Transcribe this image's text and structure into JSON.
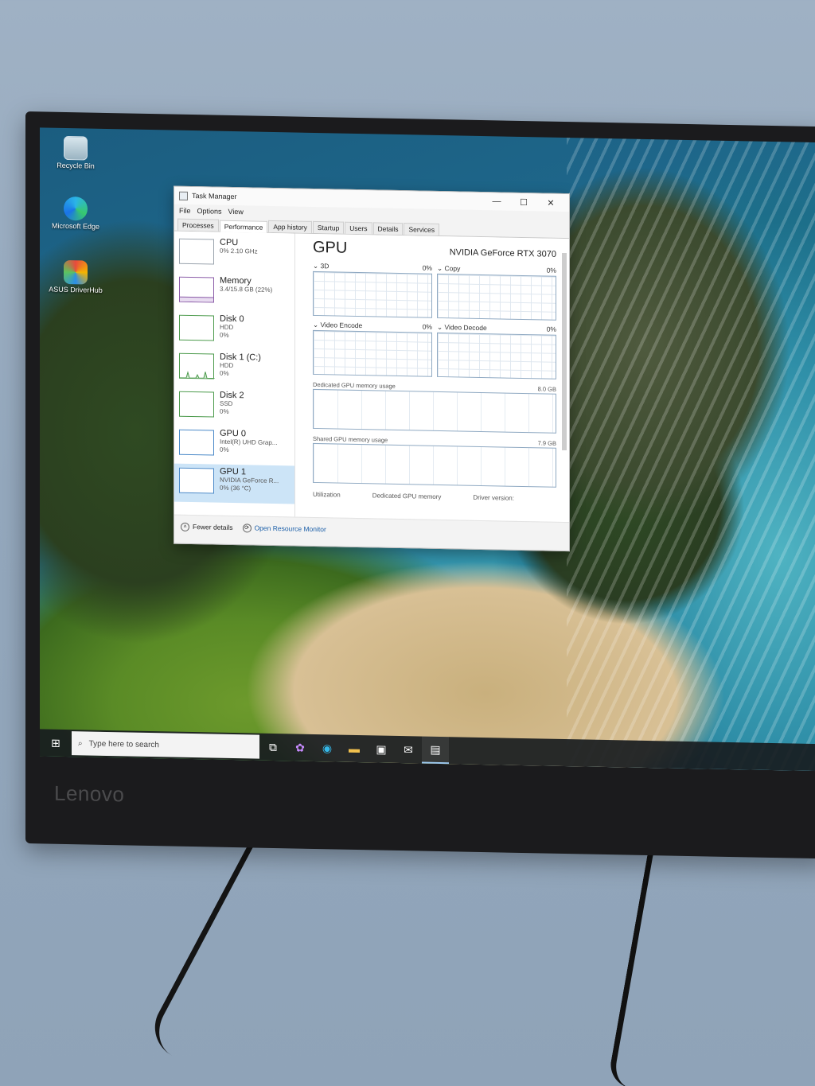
{
  "desktop": {
    "icons": [
      {
        "label": "Recycle Bin",
        "icon": "recycle-bin-icon"
      },
      {
        "label": "Microsoft Edge",
        "icon": "edge-icon"
      },
      {
        "label": "ASUS DriverHub",
        "icon": "asus-icon"
      }
    ]
  },
  "task_manager": {
    "title": "Task Manager",
    "window_controls": {
      "minimize": "—",
      "maximize": "☐",
      "close": "✕"
    },
    "menu": [
      "File",
      "Options",
      "View"
    ],
    "tabs": [
      "Processes",
      "Performance",
      "App history",
      "Startup",
      "Users",
      "Details",
      "Services"
    ],
    "active_tab": "Performance",
    "sidebar": [
      {
        "name": "CPU",
        "line1": "0%  2.10 GHz",
        "line2": ""
      },
      {
        "name": "Memory",
        "line1": "3.4/15.8 GB (22%)",
        "line2": ""
      },
      {
        "name": "Disk 0",
        "line1": "HDD",
        "line2": "0%"
      },
      {
        "name": "Disk 1 (C:)",
        "line1": "HDD",
        "line2": "0%"
      },
      {
        "name": "Disk 2",
        "line1": "SSD",
        "line2": "0%"
      },
      {
        "name": "GPU 0",
        "line1": "Intel(R) UHD Grap...",
        "line2": "0%"
      },
      {
        "name": "GPU 1",
        "line1": "NVIDIA GeForce R...",
        "line2": "0% (36 °C)"
      }
    ],
    "selected_index": 6,
    "main": {
      "title": "GPU",
      "model": "NVIDIA GeForce RTX 3070",
      "engines": [
        {
          "label": "3D",
          "value": "0%"
        },
        {
          "label": "Copy",
          "value": "0%"
        },
        {
          "label": "Video Encode",
          "value": "0%"
        },
        {
          "label": "Video Decode",
          "value": "0%"
        }
      ],
      "dedicated_label": "Dedicated GPU memory usage",
      "dedicated_max": "8.0 GB",
      "shared_label": "Shared GPU memory usage",
      "shared_max": "7.9 GB",
      "stats": [
        "Utilization",
        "Dedicated GPU memory",
        "Driver version:"
      ]
    },
    "footer": {
      "fewer_details": "Fewer details",
      "open_resource_monitor": "Open Resource Monitor"
    }
  },
  "taskbar": {
    "search_placeholder": "Type here to search",
    "apps": [
      "task-view-icon",
      "copilot-icon",
      "edge-icon",
      "file-explorer-icon",
      "store-icon",
      "mail-icon",
      "task-manager-icon"
    ]
  },
  "monitor": {
    "brand": "Lenovo"
  }
}
